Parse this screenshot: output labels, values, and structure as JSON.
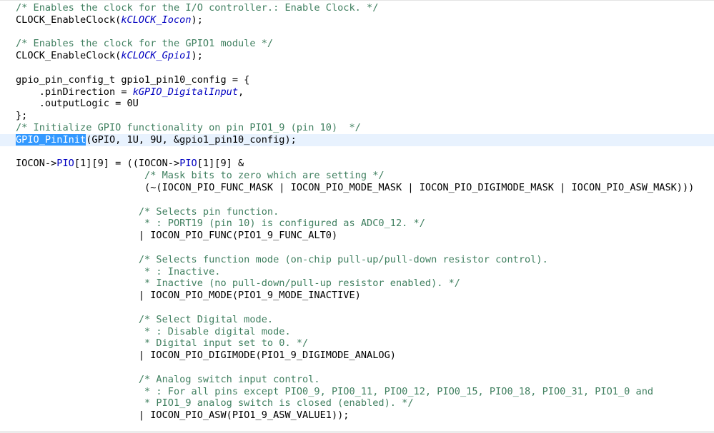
{
  "editor": {
    "current_line": 11,
    "lines": [
      [
        {
          "t": "/* Enables the clock for the I/O controller.: Enable Clock. */",
          "c": "comment"
        }
      ],
      [
        {
          "t": "CLOCK_EnableClock(",
          "c": "plain"
        },
        {
          "t": "kCLOCK_Iocon",
          "c": "const"
        },
        {
          "t": ");",
          "c": "plain"
        }
      ],
      [],
      [
        {
          "t": "/* Enables the clock for the GPIO1 module */",
          "c": "comment"
        }
      ],
      [
        {
          "t": "CLOCK_EnableClock(",
          "c": "plain"
        },
        {
          "t": "kCLOCK_Gpio1",
          "c": "const"
        },
        {
          "t": ");",
          "c": "plain"
        }
      ],
      [],
      [
        {
          "t": "gpio_pin_config_t gpio1_pin10_config = {",
          "c": "plain"
        }
      ],
      [
        {
          "t": "    .pinDirection = ",
          "c": "plain"
        },
        {
          "t": "kGPIO_DigitalInput",
          "c": "const"
        },
        {
          "t": ",",
          "c": "plain"
        }
      ],
      [
        {
          "t": "    .outputLogic = 0U",
          "c": "plain"
        }
      ],
      [
        {
          "t": "};",
          "c": "plain"
        }
      ],
      [
        {
          "t": "/* Initialize GPIO functionality on pin PIO1_9 (pin 10)  */",
          "c": "comment"
        }
      ],
      [
        {
          "t": "GPIO_PinInit",
          "c": "selected"
        },
        {
          "t": "(GPIO, 1U, 9U, &gpio1_pin10_config);",
          "c": "plain"
        }
      ],
      [],
      [
        {
          "t": "IOCON->",
          "c": "plain"
        },
        {
          "t": "PIO",
          "c": "field"
        },
        {
          "t": "[1][9] = ((IOCON->",
          "c": "plain"
        },
        {
          "t": "PIO",
          "c": "field"
        },
        {
          "t": "[1][9] &",
          "c": "plain"
        }
      ],
      [
        {
          "t": "                      /* Mask bits to zero which are setting */",
          "c": "comment"
        }
      ],
      [
        {
          "t": "                      (~(IOCON_PIO_FUNC_MASK | IOCON_PIO_MODE_MASK | IOCON_PIO_DIGIMODE_MASK | IOCON_PIO_ASW_MASK)))",
          "c": "plain"
        }
      ],
      [],
      [
        {
          "t": "                     /* Selects pin function.",
          "c": "comment"
        }
      ],
      [
        {
          "t": "                      * : PORT19 (pin 10) is configured as ADC0_12. */",
          "c": "comment"
        }
      ],
      [
        {
          "t": "                     | IOCON_PIO_FUNC(PIO1_9_FUNC_ALT0)",
          "c": "plain"
        }
      ],
      [],
      [
        {
          "t": "                     /* Selects function mode (on-chip pull-up/pull-down resistor control).",
          "c": "comment"
        }
      ],
      [
        {
          "t": "                      * : Inactive.",
          "c": "comment"
        }
      ],
      [
        {
          "t": "                      * Inactive (no pull-down/pull-up resistor enabled). */",
          "c": "comment"
        }
      ],
      [
        {
          "t": "                     | IOCON_PIO_MODE(PIO1_9_MODE_INACTIVE)",
          "c": "plain"
        }
      ],
      [],
      [
        {
          "t": "                     /* Select Digital mode.",
          "c": "comment"
        }
      ],
      [
        {
          "t": "                      * : Disable digital mode.",
          "c": "comment"
        }
      ],
      [
        {
          "t": "                      * Digital input set to 0. */",
          "c": "comment"
        }
      ],
      [
        {
          "t": "                     | IOCON_PIO_DIGIMODE(PIO1_9_DIGIMODE_ANALOG)",
          "c": "plain"
        }
      ],
      [],
      [
        {
          "t": "                     /* Analog switch input control.",
          "c": "comment"
        }
      ],
      [
        {
          "t": "                      * : For all pins except PIO0_9, PIO0_11, PIO0_12, PIO0_15, PIO0_18, PIO0_31, PIO1_0 and",
          "c": "comment"
        }
      ],
      [
        {
          "t": "                      * PIO1_9 analog switch is closed (enabled). */",
          "c": "comment"
        }
      ],
      [
        {
          "t": "                     | IOCON_PIO_ASW(PIO1_9_ASW_VALUE1));",
          "c": "plain"
        }
      ]
    ]
  }
}
